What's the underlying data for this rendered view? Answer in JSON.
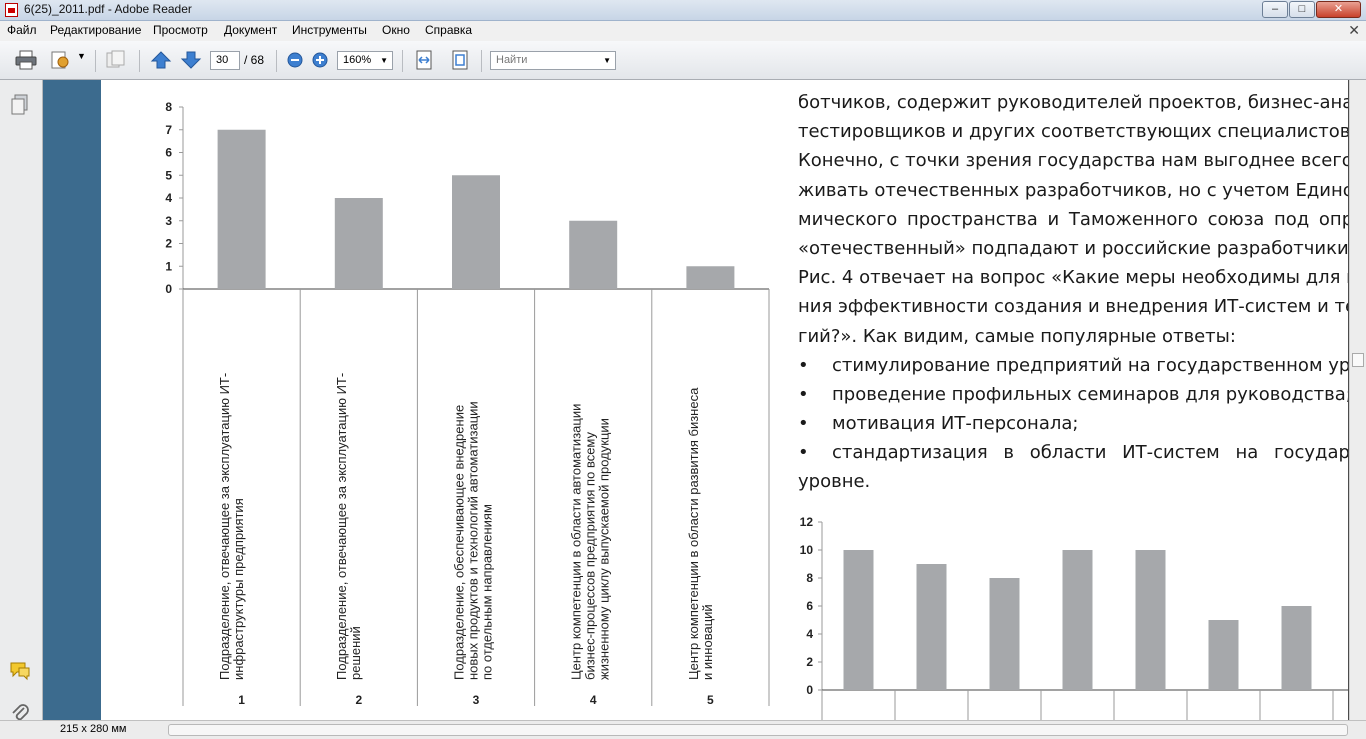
{
  "window": {
    "title": "6(25)_2011.pdf - Adobe Reader"
  },
  "menu": [
    "Файл",
    "Редактирование",
    "Просмотр",
    "Документ",
    "Инструменты",
    "Окно",
    "Справка"
  ],
  "toolbar": {
    "current_page": "30",
    "total_pages": "/ 68",
    "zoom": "160%",
    "search_placeholder": "Найти"
  },
  "status": {
    "page_size": "215 x 280 мм"
  },
  "colors": {
    "sidebar": "#3c6b8e",
    "bar": "#a6a8ab",
    "background": "#4b4b4b"
  },
  "icons": [
    "print-icon",
    "edit-icon",
    "attach-icon",
    "page-up-icon",
    "page-down-icon",
    "zoom-out-icon",
    "zoom-in-icon",
    "fit-width-icon",
    "fit-page-icon",
    "pages-panel-icon",
    "comments-panel-icon",
    "attachments-panel-icon"
  ],
  "document": {
    "text_lines": [
      "ботчиков, содержит руководителей проектов, бизнес-анали",
      "тестировщиков и других соответствующих специалистов.",
      "Конечно, с точки зрения государства нам выгоднее всего по",
      "живать отечественных разработчиков, но с учетом Единого э",
      "мического пространства и Таможенного союза под опреде",
      "«отечественный» подпадают и российские разработчики.",
      "Рис. 4 отвечает на вопрос «Какие меры необходимы для по",
      "ния эффективности создания и внедрения ИТ-систем и тех",
      "гий?». Как видим, самые популярные ответы:"
    ],
    "bullet_symbol": "•",
    "bullets": [
      "стимулирование предприятий на государственном уровн",
      "проведение профильных семинаров для руководства;",
      "мотивация ИТ-персонала;",
      "стандартизация в области ИТ-систем на государстве"
    ],
    "tail_line": "уровне."
  },
  "chart_data": [
    {
      "type": "bar",
      "categories": [
        "1",
        "2",
        "3",
        "4",
        "5"
      ],
      "category_descriptions": [
        [
          "Подразделение, отвечающее за эксплуатацию ИТ-",
          "инфраструктуры предприятия"
        ],
        [
          "Подразделение, отвечающее за эксплуатацию ИТ-",
          "решений"
        ],
        [
          "Подразделение, обеспечивающее внедрение",
          "новых продуктов и технологий автоматизации",
          "по отдельным направлениям"
        ],
        [
          "Центр компетенции в области автоматизации",
          "бизнес-процессов предприятия по всему",
          "жизненному циклу выпускаемой продукции"
        ],
        [
          "Центр компетенции в области развития бизнеса",
          "и инноваций"
        ]
      ],
      "values": [
        7,
        4,
        5,
        3,
        1
      ],
      "yticks": [
        "0",
        "1",
        "2",
        "3",
        "4",
        "5",
        "6",
        "7",
        "8"
      ],
      "ylim": [
        0,
        8
      ],
      "grid": false
    },
    {
      "type": "bar",
      "categories": [
        "",
        "",
        "",
        "",
        "",
        "",
        ""
      ],
      "values": [
        10,
        9,
        8,
        10,
        10,
        5,
        6
      ],
      "yticks": [
        "0",
        "2",
        "4",
        "6",
        "8",
        "10",
        "12"
      ],
      "ylim": [
        0,
        12
      ],
      "grid": false
    }
  ]
}
